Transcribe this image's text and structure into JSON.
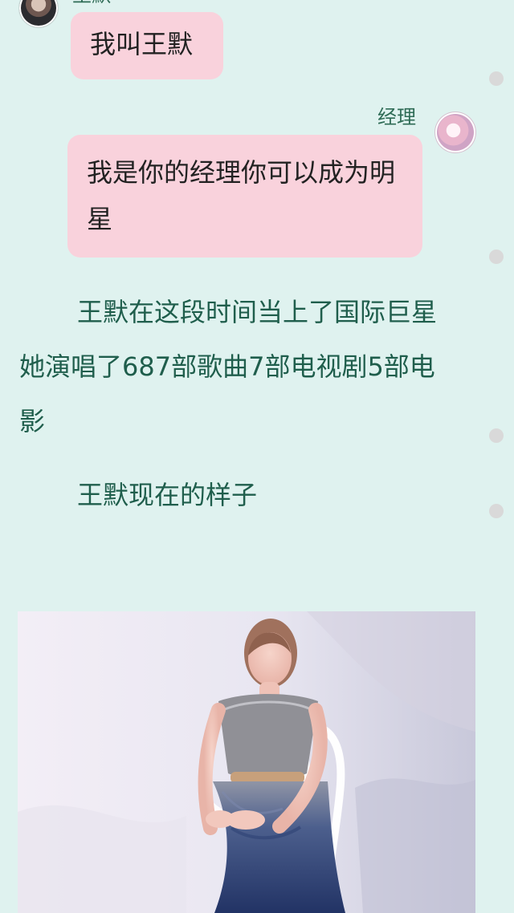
{
  "messages": {
    "left": {
      "name": "王默",
      "text": "我叫王默"
    },
    "right": {
      "name": "经理",
      "text": "我是你的经理你可以成为明星"
    }
  },
  "story": {
    "paragraph1": "王默在这段时间当上了国际巨星她演唱了687部歌曲7部电视剧5部电影",
    "paragraph2": "王默现在的样子"
  },
  "photo": {
    "type": "portrait-photo"
  }
}
